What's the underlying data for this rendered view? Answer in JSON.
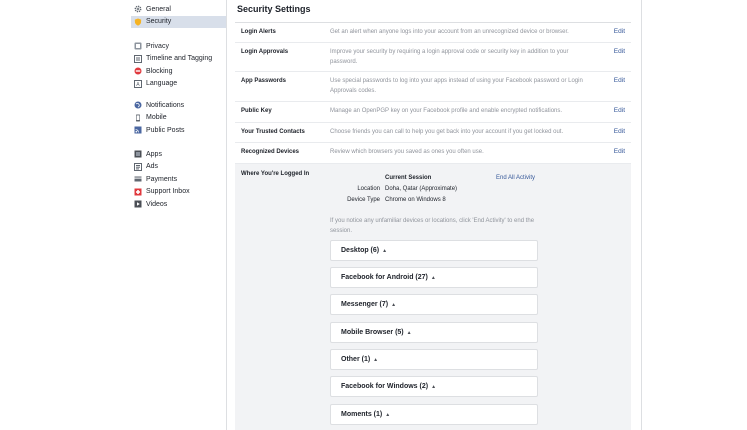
{
  "sidebar": {
    "groups": [
      [
        {
          "label": "General",
          "icon": "gear-icon"
        },
        {
          "label": "Security",
          "icon": "shield-icon",
          "active": true
        }
      ],
      [
        {
          "label": "Privacy",
          "icon": "privacy-icon"
        },
        {
          "label": "Timeline and Tagging",
          "icon": "timeline-icon"
        },
        {
          "label": "Blocking",
          "icon": "blocking-icon"
        },
        {
          "label": "Language",
          "icon": "language-icon"
        }
      ],
      [
        {
          "label": "Notifications",
          "icon": "globe-icon"
        },
        {
          "label": "Mobile",
          "icon": "mobile-icon"
        },
        {
          "label": "Public Posts",
          "icon": "rss-icon"
        }
      ],
      [
        {
          "label": "Apps",
          "icon": "apps-icon"
        },
        {
          "label": "Ads",
          "icon": "ads-icon"
        },
        {
          "label": "Payments",
          "icon": "payments-icon"
        },
        {
          "label": "Support Inbox",
          "icon": "support-icon"
        },
        {
          "label": "Videos",
          "icon": "videos-icon"
        }
      ]
    ]
  },
  "main": {
    "title": "Security Settings",
    "edit_label": "Edit",
    "rows": [
      {
        "label": "Login Alerts",
        "desc": "Get an alert when anyone logs into your account from an unrecognized device or browser."
      },
      {
        "label": "Login Approvals",
        "desc": "Improve your security by requiring a login approval code or security key in addition to your password."
      },
      {
        "label": "App Passwords",
        "desc": "Use special passwords to log into your apps instead of using your Facebook password or Login Approvals codes."
      },
      {
        "label": "Public Key",
        "desc": "Manage an OpenPGP key on your Facebook profile and enable encrypted notifications."
      },
      {
        "label": "Your Trusted Contacts",
        "desc": "Choose friends you can call to help you get back into your account if you get locked out."
      },
      {
        "label": "Recognized Devices",
        "desc": "Review which browsers you saved as ones you often use."
      }
    ],
    "logged_in": {
      "label": "Where You're Logged In",
      "current_session": "Current Session",
      "end_all": "End All Activity",
      "location_key": "Location",
      "location_val": "Doha, Qatar (Approximate)",
      "device_key": "Device Type",
      "device_val": "Chrome on Windows 8",
      "notice": "If you notice any unfamiliar devices or locations, click 'End Activity' to end the session.",
      "devices": [
        "Desktop (6)",
        "Facebook for Android (27)",
        "Messenger (7)",
        "Mobile Browser (5)",
        "Other (1)",
        "Facebook for Windows (2)",
        "Moments (1)"
      ]
    }
  }
}
